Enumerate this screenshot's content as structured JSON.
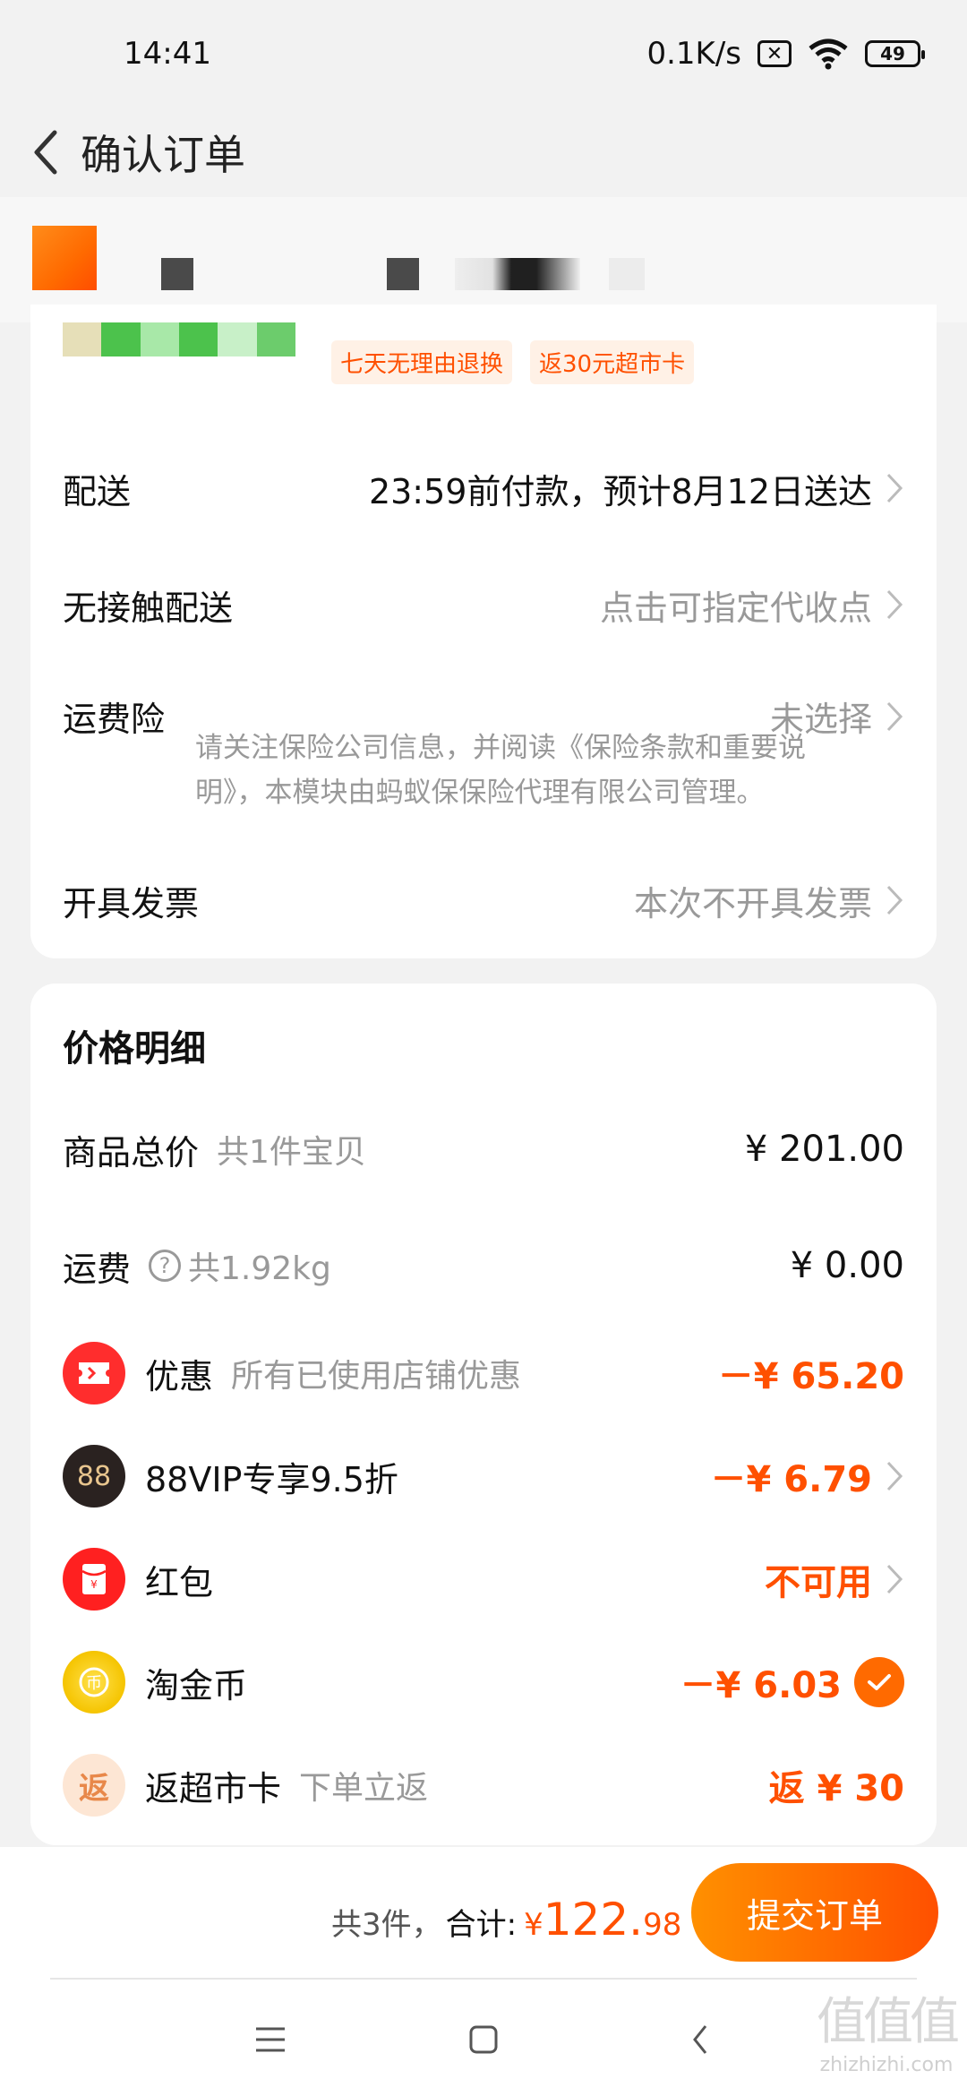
{
  "status": {
    "time": "14:41",
    "speed": "0.1K/s",
    "battery": "49"
  },
  "header": {
    "title": "确认订单"
  },
  "card1": {
    "tags": [
      "七天无理由退换",
      "返30元超市卡"
    ],
    "delivery": {
      "label": "配送",
      "value": "23:59前付款，预计8月12日送达"
    },
    "contactless": {
      "label": "无接触配送",
      "value": "点击可指定代收点"
    },
    "insurance": {
      "label": "运费险",
      "value": "未选择",
      "desc": "请关注保险公司信息，并阅读《保险条款和重要说明》，本模块由蚂蚁保保险代理有限公司管理。"
    },
    "invoice": {
      "label": "开具发票",
      "value": "本次不开具发票"
    }
  },
  "price": {
    "title": "价格明细",
    "goods": {
      "label": "商品总价",
      "sub": "共1件宝贝",
      "value": "¥ 201.00"
    },
    "shipping": {
      "label": "运费",
      "sub": "共1.92kg",
      "value": "¥ 0.00"
    },
    "discount": {
      "label": "优惠",
      "sub": "所有已使用店铺优惠",
      "value": "－¥ 65.20"
    },
    "vip": {
      "label": "88VIP专享9.5折",
      "value": "－¥ 6.79",
      "icon_text": "88"
    },
    "redpacket": {
      "label": "红包",
      "value": "不可用"
    },
    "coin": {
      "label": "淘金币",
      "value": "－¥ 6.03"
    },
    "supermarket": {
      "label": "返超市卡",
      "sub": "下单立返",
      "value": "返 ¥ 30",
      "icon_text": "返"
    }
  },
  "bottom": {
    "count": "共3件，",
    "total_label": "合计:",
    "yen": "¥",
    "int": "122.",
    "dec": "98",
    "submit": "提交订单"
  },
  "watermark": {
    "logo": "值值值",
    "site": "zhizhizhi.com"
  },
  "colors": {
    "accent": "#ff5000",
    "accent_light": "#ff9000"
  }
}
